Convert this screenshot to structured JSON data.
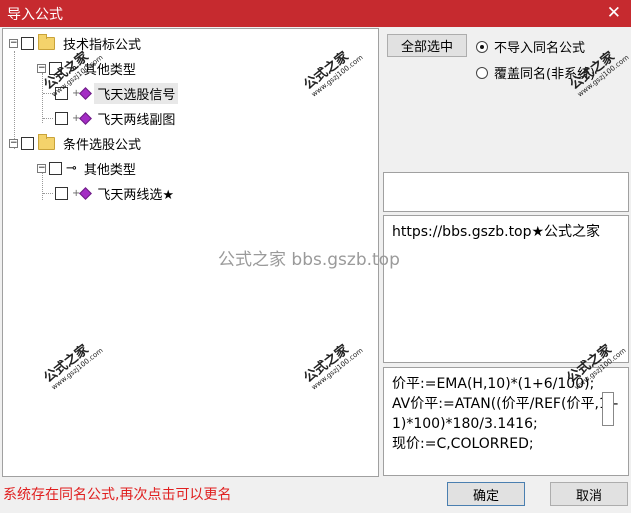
{
  "window": {
    "title": "导入公式",
    "close_glyph": "✕"
  },
  "tree": {
    "nodes": [
      {
        "id": "n1",
        "label": "技术指标公式",
        "icon": "folder-icon",
        "expander": "−"
      },
      {
        "id": "n2",
        "label": "其他类型",
        "icon": "key-icon",
        "expander": "−"
      },
      {
        "id": "n3",
        "label": "飞天选股信号",
        "icon": "formula-icon",
        "selected": true
      },
      {
        "id": "n4",
        "label": "飞天两线副图",
        "icon": "formula-icon"
      },
      {
        "id": "n5",
        "label": "条件选股公式",
        "icon": "folder-icon",
        "expander": "−"
      },
      {
        "id": "n6",
        "label": "其他类型",
        "icon": "key-icon",
        "expander": "−"
      },
      {
        "id": "n7",
        "label": "飞天两线选★",
        "icon": "formula-icon"
      }
    ]
  },
  "controls": {
    "select_all": "全部选中",
    "radio_skip": "不导入同名公式",
    "radio_overwrite": "覆盖同名(非系统)",
    "radio_selected": "skip"
  },
  "description": "https://bbs.gszb.top★公式之家",
  "formula_code": "价平:=EMA(H,10)*(1+6/100);\nAV价平:=ATAN((价平/REF(价平,1)-1)*100)*180/3.1416;\n现价:=C,COLORRED;",
  "status": {
    "message": "系统存在同名公式,再次点击可以更名",
    "color": "#e02020"
  },
  "buttons": {
    "ok": "确定",
    "cancel": "取消"
  },
  "watermarks": {
    "stamp_title": "公式之家",
    "stamp_url": "www.gszj100.com",
    "center": "公式之家 bbs.gszb.top"
  },
  "colors": {
    "titlebar": "#c62a2f",
    "background": "#f0f0f0"
  }
}
